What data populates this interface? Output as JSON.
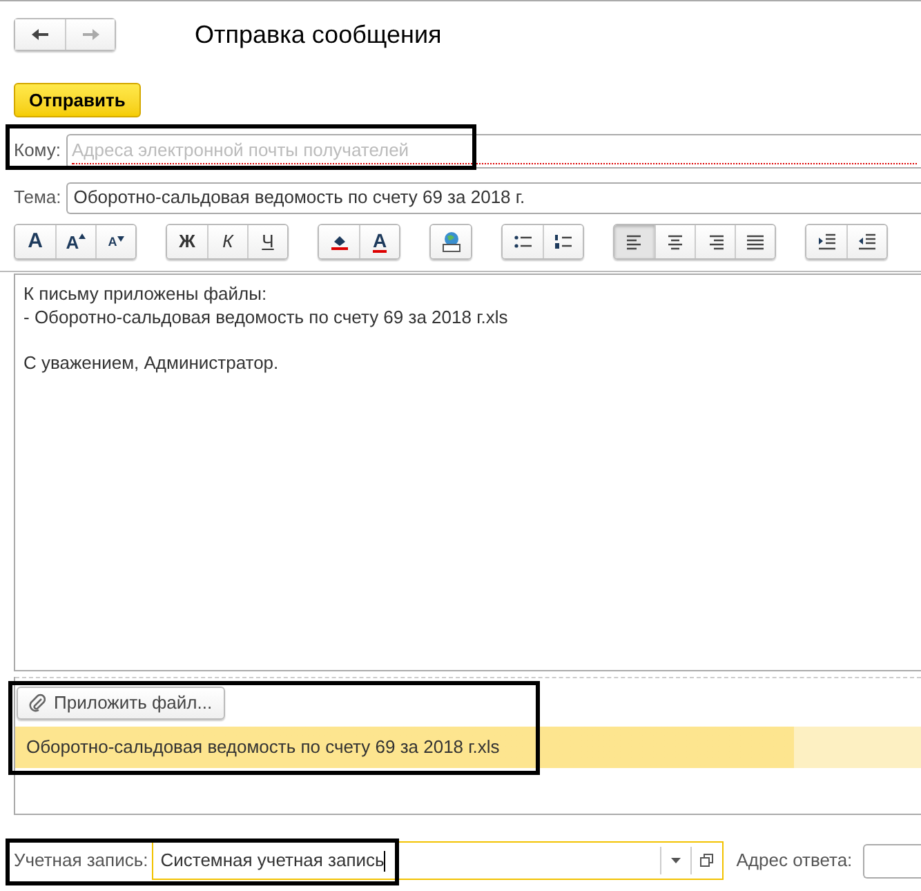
{
  "window": {
    "title": "Отправка сообщения"
  },
  "nav": [
    {
      "kind": "back",
      "disabled": false
    },
    {
      "kind": "forward",
      "disabled": true
    }
  ],
  "send_button": "Отправить",
  "to": {
    "label": "Кому:",
    "placeholder": "Адреса электронной почты получателей"
  },
  "subject": {
    "label": "Тема:",
    "value": "Оборотно-сальдовая ведомость по счету 69 за 2018 г."
  },
  "toolbar": [
    [
      {
        "kind": "font_bold",
        "label": "A",
        "selected": false
      },
      {
        "kind": "font_up",
        "label": "A",
        "selected": false
      },
      {
        "kind": "font_down",
        "label": "A",
        "selected": false
      }
    ],
    [
      {
        "kind": "bold",
        "label": "Ж",
        "selected": false
      },
      {
        "kind": "italic",
        "label": "К",
        "selected": false
      },
      {
        "kind": "underline",
        "label": "Ч",
        "selected": false
      }
    ],
    [
      {
        "kind": "fill",
        "selected": false
      },
      {
        "kind": "color",
        "label": "A",
        "selected": false
      }
    ],
    [
      {
        "kind": "image",
        "selected": false
      }
    ],
    [
      {
        "kind": "bullets",
        "selected": false
      },
      {
        "kind": "numbers",
        "selected": false
      }
    ],
    [
      {
        "kind": "align_left",
        "selected": true
      },
      {
        "kind": "align_center",
        "selected": false
      },
      {
        "kind": "align_right",
        "selected": false
      },
      {
        "kind": "justify",
        "selected": false
      }
    ],
    [
      {
        "kind": "indent",
        "selected": false
      },
      {
        "kind": "outdent",
        "selected": false
      }
    ]
  ],
  "body": [
    [
      "К письму приложены файлы:",
      "- Оборотно-сальдовая ведомость по счету 69 за 2018 г.xls"
    ],
    [
      "С уважением, Администратор."
    ]
  ],
  "attach_button": "Приложить файл...",
  "attachments": [
    {
      "name": "Оборотно-сальдовая ведомость по счету 69 за 2018 г.xls",
      "selected": true
    }
  ],
  "account": {
    "label": "Учетная запись:",
    "value": "Системная учетная запись"
  },
  "reply_to": {
    "label": "Адрес ответа:"
  }
}
